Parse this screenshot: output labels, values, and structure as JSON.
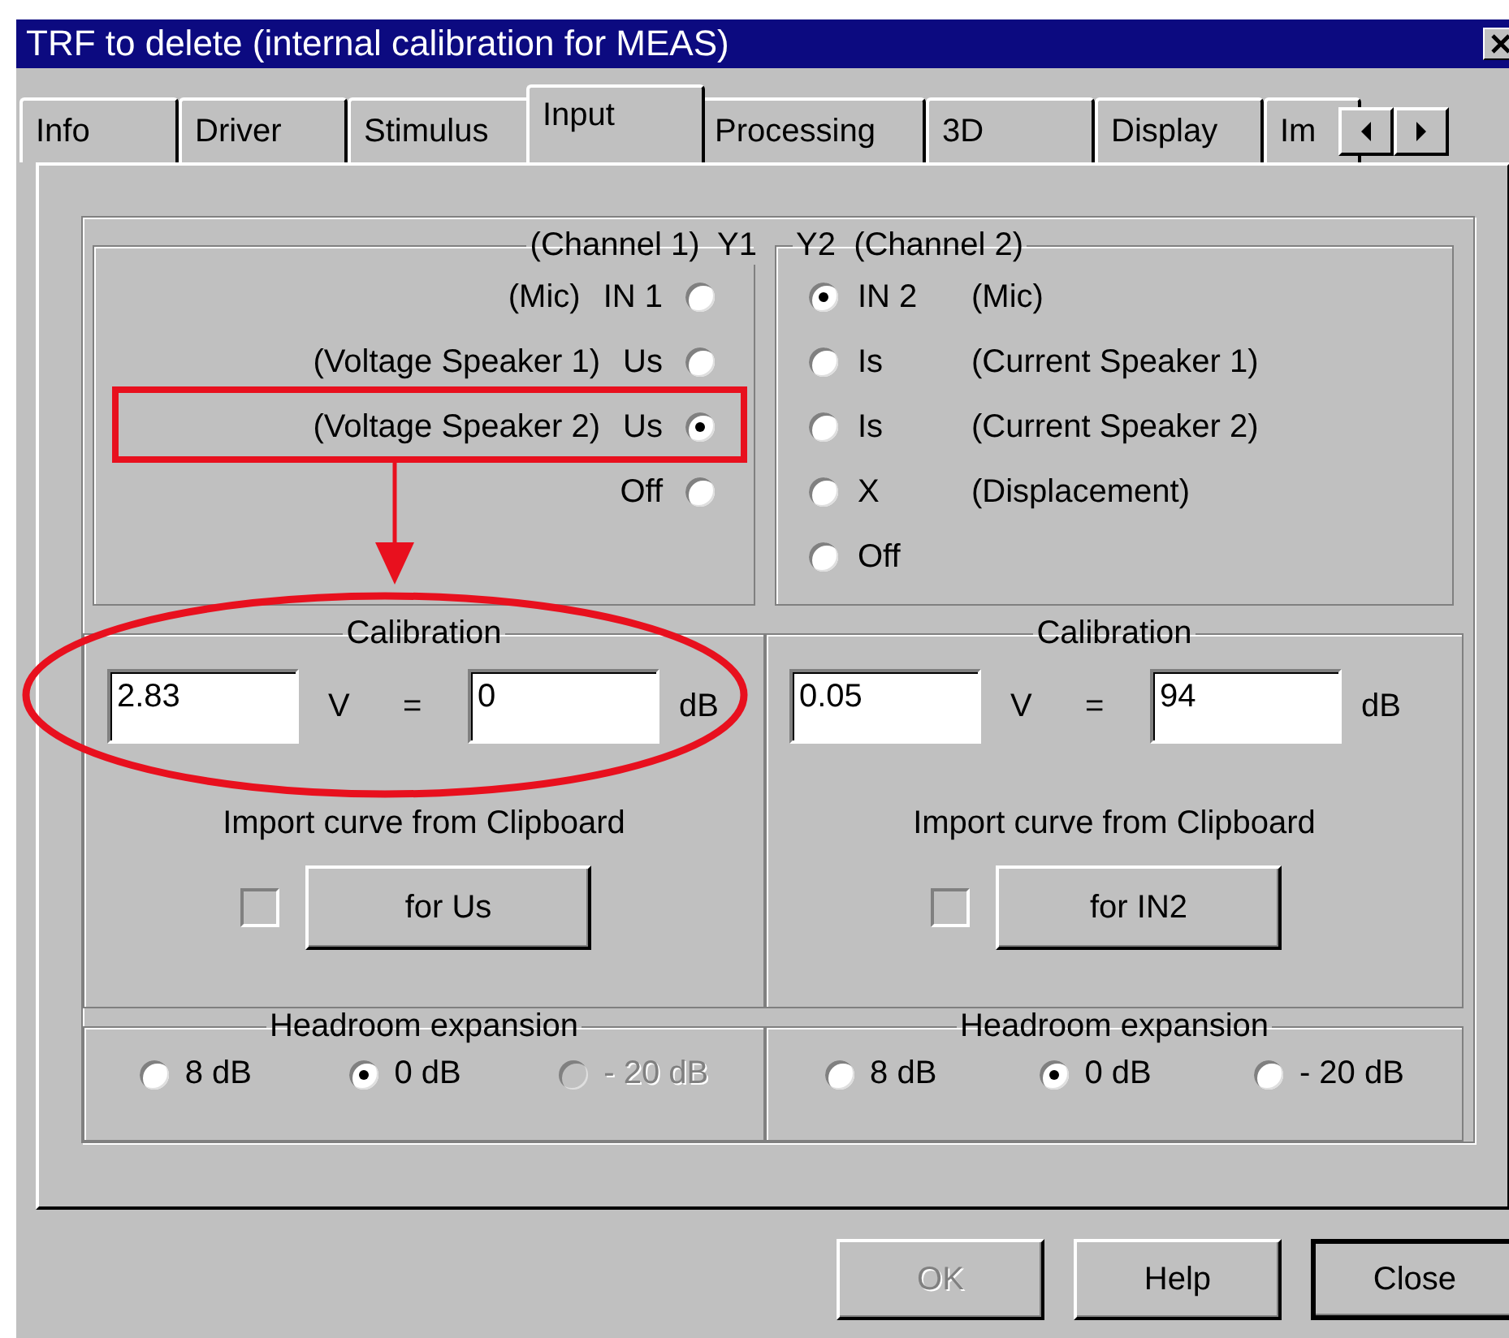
{
  "window": {
    "title": "TRF to delete (internal calibration for MEAS)"
  },
  "tabs": [
    {
      "label": "Info",
      "selected": false
    },
    {
      "label": "Driver",
      "selected": false
    },
    {
      "label": "Stimulus",
      "selected": false
    },
    {
      "label": "Input",
      "selected": true
    },
    {
      "label": "Processing",
      "selected": false
    },
    {
      "label": "3D",
      "selected": false
    },
    {
      "label": "Display",
      "selected": false
    },
    {
      "label": "Im",
      "selected": false
    }
  ],
  "channels": [
    {
      "legend": "(Channel 1)  Y1",
      "options": [
        {
          "label": "IN 1",
          "note": "(Mic)",
          "selected": false
        },
        {
          "label": "Us",
          "note": "(Voltage Speaker 1)",
          "selected": false
        },
        {
          "label": "Us",
          "note": "(Voltage Speaker 2)",
          "selected": true
        },
        {
          "label": "Off",
          "selected": false
        }
      ],
      "calibration": {
        "legend": "Calibration",
        "volts": "2.83",
        "volt_unit": "V",
        "equals": "=",
        "db": "0",
        "db_unit": "dB"
      },
      "import": {
        "label": "Import curve from Clipboard",
        "checked": false,
        "button": "for Us"
      },
      "headroom": {
        "legend": "Headroom expansion",
        "options": [
          {
            "label": "8 dB",
            "selected": false,
            "disabled": false
          },
          {
            "label": "0 dB",
            "selected": true,
            "disabled": false
          },
          {
            "label": "- 20 dB",
            "selected": false,
            "disabled": true
          }
        ]
      }
    },
    {
      "legend": "Y2  (Channel 2)",
      "options": [
        {
          "label": "IN 2",
          "note": "(Mic)",
          "selected": true
        },
        {
          "label": "Is",
          "note": "(Current Speaker 1)",
          "selected": false
        },
        {
          "label": "Is",
          "note": "(Current Speaker 2)",
          "selected": false
        },
        {
          "label": "X",
          "note": "(Displacement)",
          "selected": false
        },
        {
          "label": "Off",
          "selected": false
        }
      ],
      "calibration": {
        "legend": "Calibration",
        "volts": "0.05",
        "volt_unit": "V",
        "equals": "=",
        "db": "94",
        "db_unit": "dB"
      },
      "import": {
        "label": "Import curve from Clipboard",
        "checked": false,
        "button": "for IN2"
      },
      "headroom": {
        "legend": "Headroom expansion",
        "options": [
          {
            "label": "8 dB",
            "selected": false,
            "disabled": false
          },
          {
            "label": "0 dB",
            "selected": true,
            "disabled": false
          },
          {
            "label": "- 20 dB",
            "selected": false,
            "disabled": false
          }
        ]
      }
    }
  ],
  "buttons": [
    {
      "label": "OK",
      "disabled": true,
      "default": false
    },
    {
      "label": "Help",
      "disabled": false,
      "default": false
    },
    {
      "label": "Close",
      "disabled": false,
      "default": true
    }
  ],
  "annotations": [
    {
      "kind": "rectangle"
    },
    {
      "kind": "arrow"
    },
    {
      "kind": "ellipse"
    }
  ]
}
